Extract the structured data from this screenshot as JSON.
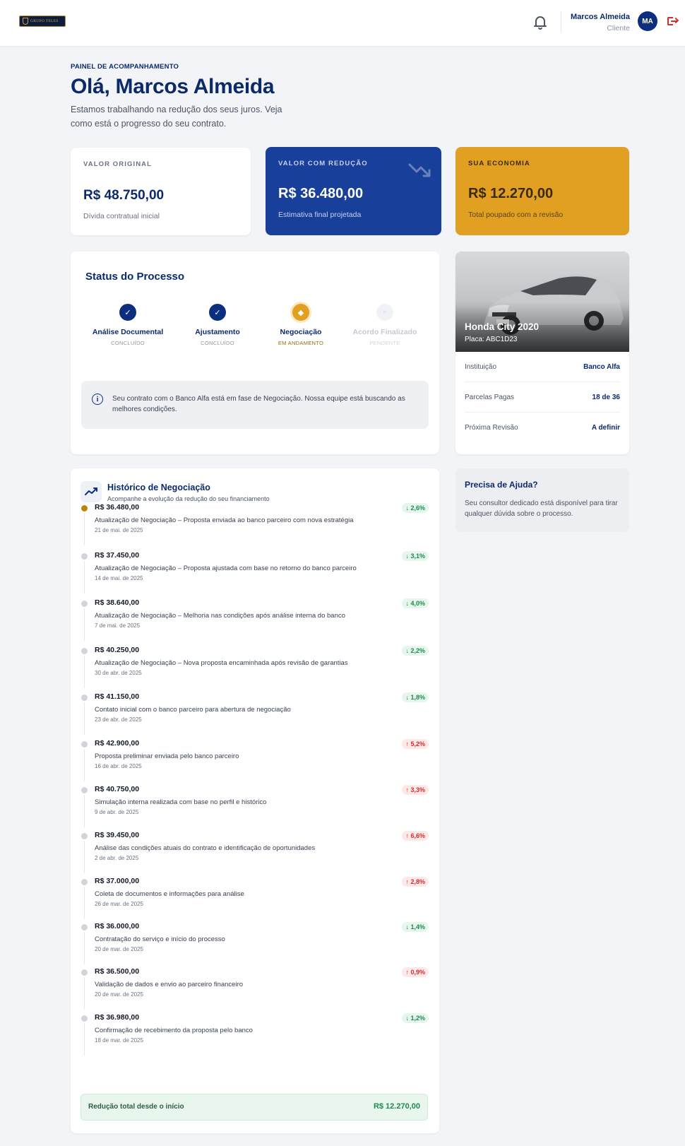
{
  "header": {
    "logo_text": "GRUPO TELES",
    "user_name": "Marcos Almeida",
    "user_role": "Cliente",
    "avatar_initials": "MA",
    "icons": [
      "bell-icon",
      "logout-icon"
    ]
  },
  "greeting": {
    "eyebrow": "PAINEL DE ACOMPANHAMENTO",
    "title": "Olá, Marcos Almeida",
    "subtitle": "Estamos trabalhando na redução dos seus juros. Veja como está o progresso do seu contrato."
  },
  "summary": {
    "original": {
      "label": "VALOR ORIGINAL",
      "value": "R$ 48.750,00",
      "caption": "Dívida contratual inicial"
    },
    "reduced": {
      "label": "VALOR COM REDUÇÃO",
      "value": "R$ 36.480,00",
      "caption": "Estimativa final projetada"
    },
    "economy": {
      "label": "SUA ECONOMIA",
      "value": "R$ 12.270,00",
      "caption": "Total poupado com a revisão"
    }
  },
  "status": {
    "title": "Status do Processo",
    "steps": [
      {
        "label": "Análise Documental",
        "state": "CONCLUÍDO"
      },
      {
        "label": "Ajustamento",
        "state": "CONCLUÍDO"
      },
      {
        "label": "Negociação",
        "state": "EM ANDAMENTO"
      },
      {
        "label": "Acordo Finalizado",
        "state": "PENDENTE"
      }
    ],
    "info": "Seu contrato com o Banco Alfa está em fase de Negociação. Nossa equipe está buscando as melhores condições."
  },
  "vehicle": {
    "name": "Honda City 2020",
    "plate": "Placa: ABC1D23",
    "details": [
      {
        "key": "Instituição",
        "value": "Banco Alfa"
      },
      {
        "key": "Parcelas Pagas",
        "value": "18 de 36"
      },
      {
        "key": "Próxima Revisão",
        "value": "A definir"
      }
    ]
  },
  "help": {
    "title": "Precisa de Ajuda?",
    "text": "Seu consultor dedicado está disponível para tirar qualquer dúvida sobre o processo."
  },
  "history": {
    "title": "Histórico de Negociação",
    "subtitle": "Acompanhe a evolução da redução do seu financiamento",
    "entries": [
      {
        "amount": "R$ 36.480,00",
        "desc": "Atualização de Negociação – Proposta enviada ao banco parceiro com nova estratégia",
        "date": "21 de mai. de 2025",
        "change": "↓ 2,6%",
        "direction": "down"
      },
      {
        "amount": "R$ 37.450,00",
        "desc": "Atualização de Negociação – Proposta ajustada com base no retorno do banco parceiro",
        "date": "14 de mai. de 2025",
        "change": "↓ 3,1%",
        "direction": "down"
      },
      {
        "amount": "R$ 38.640,00",
        "desc": "Atualização de Negociação – Melhoria nas condições após análise interna do banco",
        "date": "7 de mai. de 2025",
        "change": "↓ 4,0%",
        "direction": "down"
      },
      {
        "amount": "R$ 40.250,00",
        "desc": "Atualização de Negociação – Nova proposta encaminhada após revisão de garantias",
        "date": "30 de abr. de 2025",
        "change": "↓ 2,2%",
        "direction": "down"
      },
      {
        "amount": "R$ 41.150,00",
        "desc": "Contato inicial com o banco parceiro para abertura de negociação",
        "date": "23 de abr. de 2025",
        "change": "↓ 1,8%",
        "direction": "down"
      },
      {
        "amount": "R$ 42.900,00",
        "desc": "Proposta preliminar enviada pelo banco parceiro",
        "date": "16 de abr. de 2025",
        "change": "↑ 5,2%",
        "direction": "up"
      },
      {
        "amount": "R$ 40.750,00",
        "desc": "Simulação interna realizada com base no perfil e histórico",
        "date": "9 de abr. de 2025",
        "change": "↑ 3,3%",
        "direction": "up"
      },
      {
        "amount": "R$ 39.450,00",
        "desc": "Análise das condições atuais do contrato e identificação de oportunidades",
        "date": "2 de abr. de 2025",
        "change": "↑ 6,6%",
        "direction": "up"
      },
      {
        "amount": "R$ 37.000,00",
        "desc": "Coleta de documentos e informações para análise",
        "date": "26 de mar. de 2025",
        "change": "↑ 2,8%",
        "direction": "up"
      },
      {
        "amount": "R$ 36.000,00",
        "desc": "Contratação do serviço e início do processo",
        "date": "20 de mar. de 2025",
        "change": "↓ 1,4%",
        "direction": "down"
      },
      {
        "amount": "R$ 36.500,00",
        "desc": "Validação de dados e envio ao parceiro financeiro",
        "date": "20 de mar. de 2025",
        "change": "↑ 0,9%",
        "direction": "up"
      },
      {
        "amount": "R$ 36.980,00",
        "desc": "Confirmação de recebimento da proposta pelo banco",
        "date": "18 de mar. de 2025",
        "change": "↓ 1,2%",
        "direction": "down"
      }
    ],
    "total_label": "Redução total desde o início",
    "total_value": "R$ 12.270,00"
  }
}
